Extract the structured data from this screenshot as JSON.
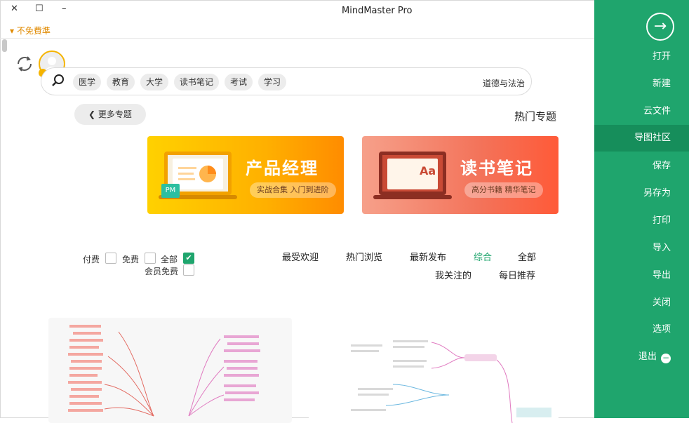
{
  "window": {
    "title": "MindMaster Pro",
    "buttons": {
      "close": "✕",
      "maximize": "☐",
      "minimize": "–"
    },
    "ribbon_toggle": "▾ 不免費準"
  },
  "sidebar": {
    "back_icon": "arrow-right-circle-icon",
    "items": [
      {
        "label": "打开"
      },
      {
        "label": "新建"
      },
      {
        "label": "云文件"
      },
      {
        "label": "导图社区",
        "active": true
      },
      {
        "label": "保存"
      },
      {
        "label": "另存为"
      },
      {
        "label": "打印"
      },
      {
        "label": "导入"
      },
      {
        "label": "导出"
      },
      {
        "label": "关闭"
      },
      {
        "label": "选项"
      },
      {
        "label": "退出",
        "icon": "minus-circle-icon"
      }
    ]
  },
  "search": {
    "placeholder": "道德与法治",
    "tags": [
      "学习",
      "考试",
      "读书笔记",
      "大学",
      "教育",
      "医学"
    ]
  },
  "hot": {
    "title": "热门专题",
    "more_label": "更多专题",
    "banners": [
      {
        "title": "读书笔记",
        "subtitle": "高分书籍 精华笔记",
        "glyph": "Aa"
      },
      {
        "title": "产品经理",
        "subtitle": "实战合集 入门到进阶",
        "badge": "PM"
      }
    ]
  },
  "filters": {
    "tabs": [
      "全部",
      "综合",
      "最新发布",
      "热门浏览",
      "最受欢迎"
    ],
    "tabs_row2": [
      "每日推荐",
      "我关注的"
    ],
    "active_tab": "综合",
    "checkboxes": [
      {
        "label": "全部",
        "checked": true
      },
      {
        "label": "免费",
        "checked": false
      },
      {
        "label": "付费",
        "checked": false
      },
      {
        "label": "会员免费",
        "checked": false
      }
    ]
  },
  "colors": {
    "sidebar": "#1fa56d",
    "sidebar_active": "#168e5b",
    "accent_orange": "#e08a00",
    "reading_banner": "#f3735a",
    "pm_banner": "#ffb000"
  }
}
